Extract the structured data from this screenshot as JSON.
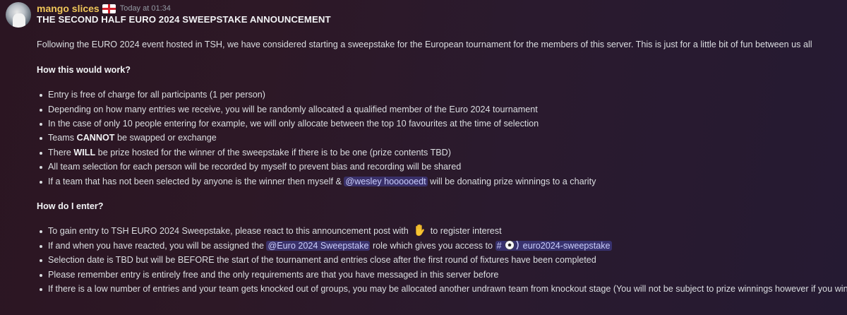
{
  "message": {
    "author": "mango slices",
    "author_badge": "england-flag-icon",
    "timestamp": "Today at 01:34",
    "title": "THE SECOND HALF EURO 2024 SWEEPSTAKE ANNOUNCEMENT",
    "intro": "Following the EURO 2024 event hosted in TSH, we have considered starting a sweepstake for the European tournament for the members of this server. This is just for a little bit of fun between us all",
    "section1_heading": "How this would work?",
    "section1_items": {
      "i0": "Entry is free of charge for all participants (1 per person)",
      "i1": "Depending on how many entries we receive, you will be randomly allocated a qualified member of the Euro 2024 tournament",
      "i2": "In the case of only 10 people entering for example, we will only allocate between the top 10 favourites at the time of selection",
      "i3_pre": "Teams ",
      "i3_bold": "CANNOT",
      "i3_post": " be swapped or exchange",
      "i4_pre": "There ",
      "i4_bold": "WILL",
      "i4_post": " be prize hosted for the winner of the sweepstake if there is to be one (prize contents TBD)",
      "i5": "All team selection for each person will be recorded by myself to prevent bias and recording will be shared",
      "i6_pre": "If a team that has not been selected by anyone is the winner then myself & ",
      "i6_mention": "@wesley hoooooedt",
      "i6_post": " will be donating prize winnings to a charity"
    },
    "section2_heading": "How do I enter?",
    "section2_items": {
      "i0_pre": "To gain entry to TSH EURO 2024 Sweepstake, please react to this announcement post with",
      "i0_post": "to register interest",
      "i1_pre": "If and when you have reacted, you will be assigned the ",
      "i1_role": "@Euro 2024 Sweepstake",
      "i1_mid": " role which gives you access to ",
      "i1_channel": "euro2024-sweepstake",
      "i2": "Selection date is TBD but will be BEFORE the start of the tournament and entries close after the first round of fixtures have been completed",
      "i3": "Please remember entry is entirely free and the only requirements are that you have messaged in this server before",
      "i4": "If there is a low number of entries and your team gets knocked out of groups, you may be allocated another undrawn team from knockout stage (You will not be subject to prize winnings however if you win"
    }
  },
  "colors": {
    "username": "#f0c659",
    "mention_bg": "rgba(88,101,242,0.32)",
    "mention_text": "#c9cdfb",
    "text": "#dbdee1"
  }
}
